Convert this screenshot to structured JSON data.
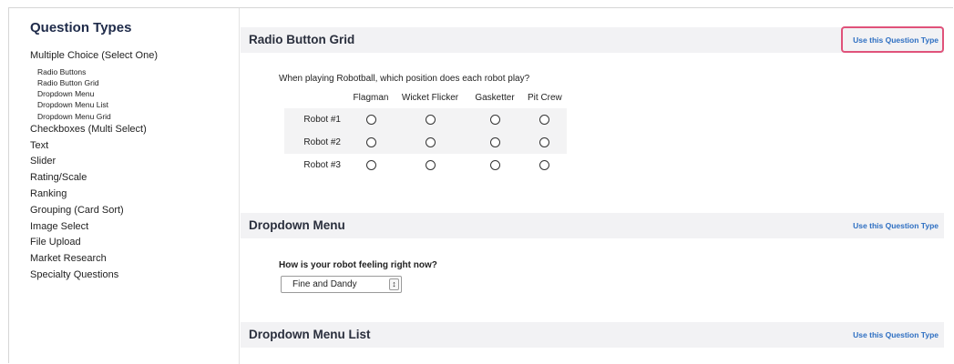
{
  "sidebar": {
    "title": "Question Types",
    "items": [
      {
        "label": "Multiple Choice (Select One)",
        "level": 0
      },
      {
        "label": "Radio Buttons",
        "level": 1
      },
      {
        "label": "Radio Button Grid",
        "level": 1
      },
      {
        "label": "Dropdown Menu",
        "level": 1
      },
      {
        "label": "Dropdown Menu List",
        "level": 1
      },
      {
        "label": "Dropdown Menu Grid",
        "level": 1
      },
      {
        "label": "Checkboxes (Multi Select)",
        "level": 0
      },
      {
        "label": "Text",
        "level": 0
      },
      {
        "label": "Slider",
        "level": 0
      },
      {
        "label": "Rating/Scale",
        "level": 0
      },
      {
        "label": "Ranking",
        "level": 0
      },
      {
        "label": "Grouping (Card Sort)",
        "level": 0
      },
      {
        "label": "Image Select",
        "level": 0
      },
      {
        "label": "File Upload",
        "level": 0
      },
      {
        "label": "Market Research",
        "level": 0
      },
      {
        "label": "Specialty Questions",
        "level": 0
      }
    ]
  },
  "sections": {
    "radio_grid": {
      "title": "Radio Button Grid",
      "use_label": "Use this Question Type",
      "question": "When playing Robotball, which position does each robot play?",
      "columns": [
        "Flagman",
        "Wicket Flicker",
        "Gasketter",
        "Pit Crew"
      ],
      "rows": [
        "Robot #1",
        "Robot #2",
        "Robot #3"
      ]
    },
    "dropdown": {
      "title": "Dropdown Menu",
      "use_label": "Use this Question Type",
      "question": "How is your robot feeling right now?",
      "selected": "Fine and Dandy"
    },
    "dropdown_list": {
      "title": "Dropdown Menu List",
      "use_label": "Use this Question Type"
    }
  },
  "colors": {
    "accent_link": "#2e6fc2",
    "highlight_border": "#e0527a",
    "header_bg": "#f2f2f4"
  }
}
